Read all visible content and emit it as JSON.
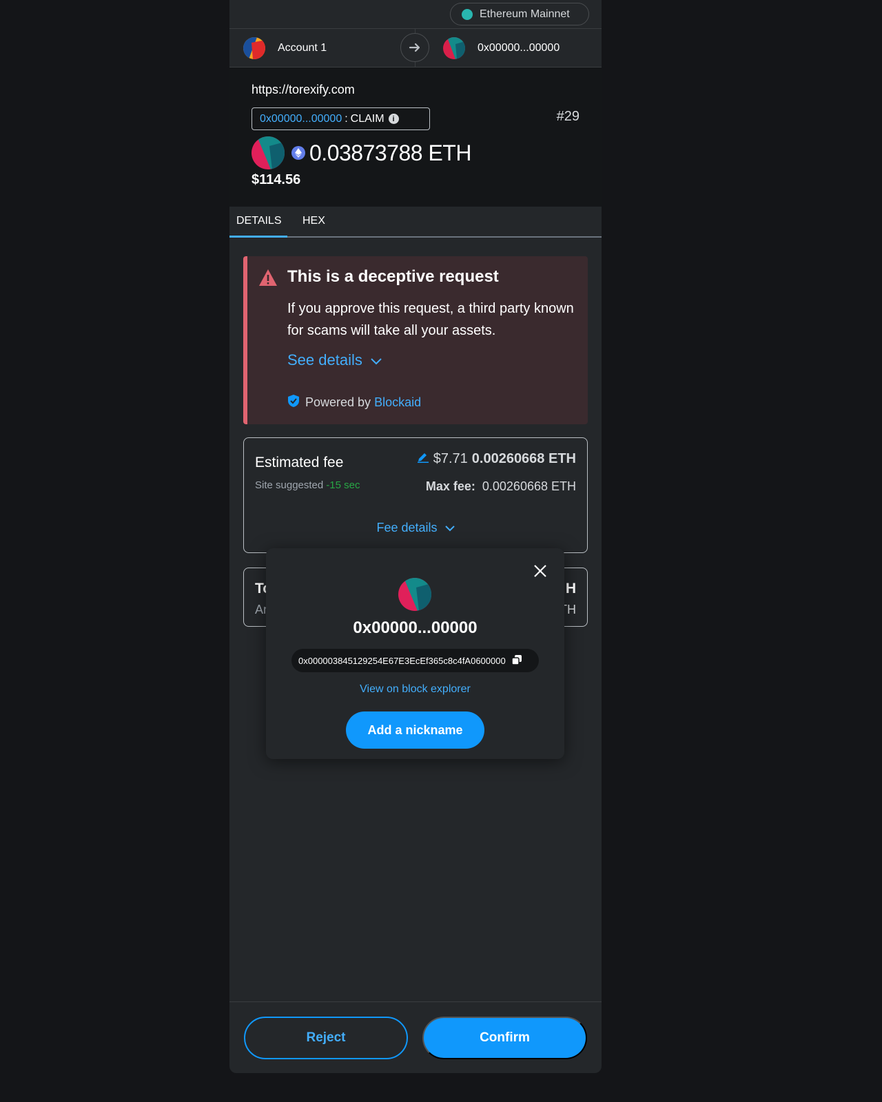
{
  "network": {
    "name": "Ethereum Mainnet",
    "dot_color": "#29b6af"
  },
  "accounts": {
    "from": "Account 1",
    "to": "0x00000...00000"
  },
  "transaction": {
    "origin": "https://torexify.com",
    "contract_short": "0x00000...00000",
    "method_sep": ":",
    "method": "CLAIM",
    "nonce": "#29",
    "amount": "0.03873788 ETH",
    "fiat": "$114.56"
  },
  "tabs": [
    {
      "label": "DETAILS",
      "active": true
    },
    {
      "label": "HEX",
      "active": false
    }
  ],
  "alert": {
    "title": "This is a deceptive request",
    "body": "If you approve this request, a third party known for scams will take all your assets.",
    "see_details": "See details",
    "powered_by": "Powered by",
    "brand": "Blockaid"
  },
  "fee": {
    "label": "Estimated fee",
    "site_suggested": "Site suggested",
    "time": "-15 sec",
    "fiat": "$7.71",
    "eth": "0.00260668 ETH",
    "max_label": "Max fee:",
    "max_value": "0.00260668 ETH",
    "details_link": "Fee details"
  },
  "total": {
    "label_partial": "To",
    "sub_partial": "Ar",
    "right_partial": "H",
    "right_sub_partial": "TH"
  },
  "popover": {
    "title": "0x00000...00000",
    "full_address": "0x000003845129254E67E3EcEf365c8c4fA0600000",
    "explorer_link": "View on block explorer",
    "nickname_button": "Add a nickname"
  },
  "footer": {
    "reject": "Reject",
    "confirm": "Confirm"
  },
  "colors": {
    "accent": "#1098fc",
    "link": "#43aefc",
    "danger": "#e06470",
    "success": "#28a745"
  }
}
